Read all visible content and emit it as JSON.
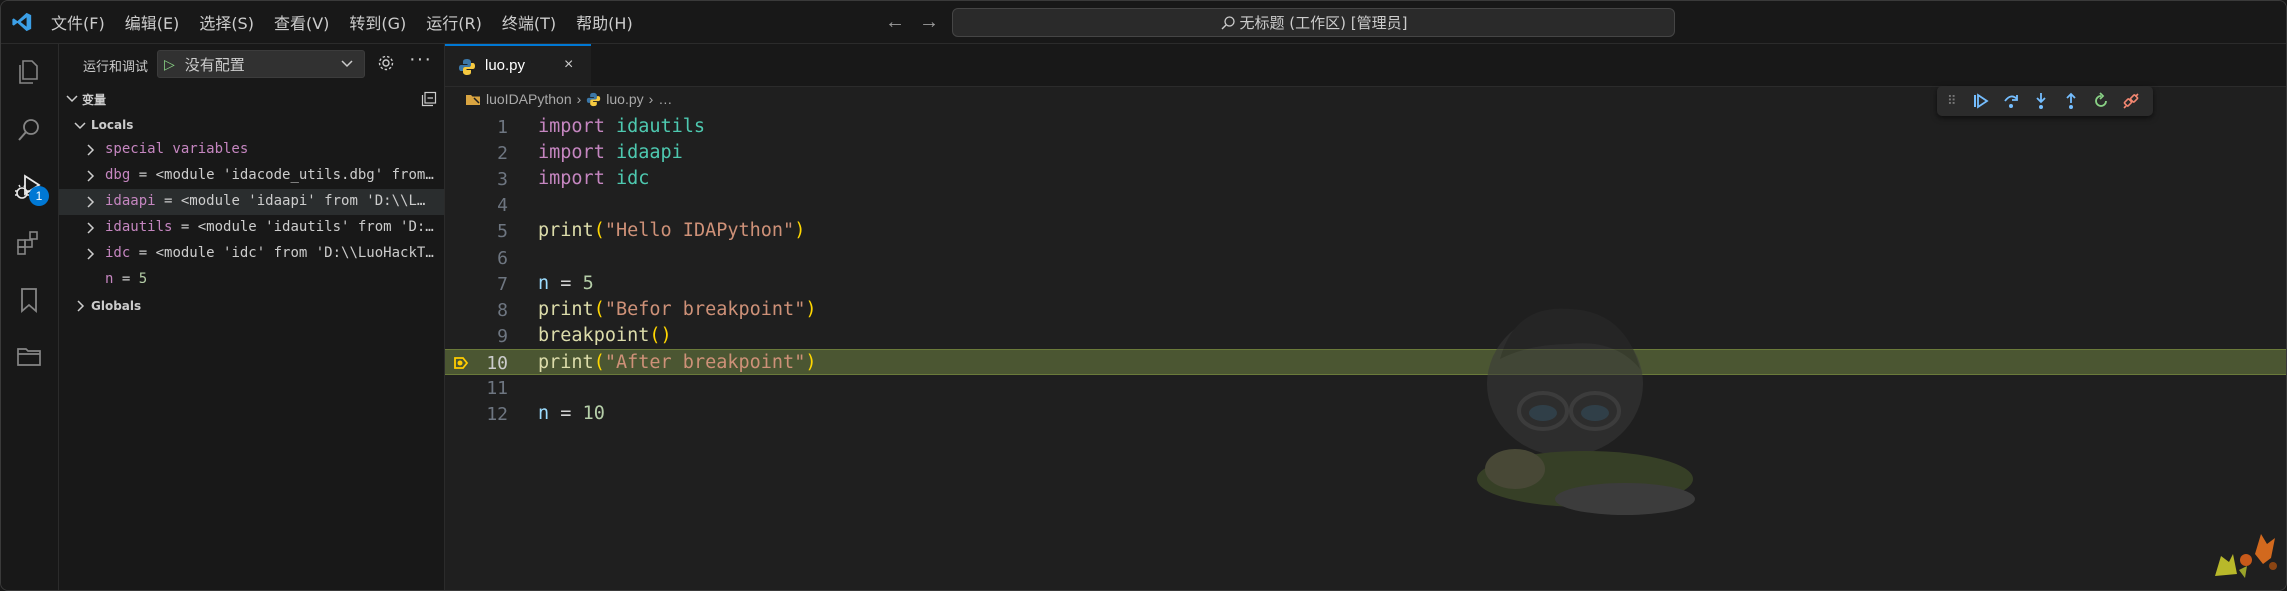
{
  "colors": {
    "accent": "#0078d4",
    "current_line": "#4b5632",
    "keyword": "#c586c0",
    "module": "#4ec9b0",
    "function": "#dcdcaa",
    "string": "#ce9178",
    "number": "#b5cea8",
    "variable": "#9cdcfe"
  },
  "menu": [
    "文件(F)",
    "编辑(E)",
    "选择(S)",
    "查看(V)",
    "转到(G)",
    "运行(R)",
    "终端(T)",
    "帮助(H)"
  ],
  "search": {
    "text": "无标题 (工作区) [管理员]"
  },
  "activity": {
    "items": [
      "explorer-icon",
      "search-icon",
      "run-debug-icon",
      "extensions-icon",
      "bookmark-icon",
      "folder-icon"
    ],
    "badge": "1"
  },
  "sidebar": {
    "title": "运行和调试",
    "config_label": "没有配置",
    "section": "变量",
    "locals": "Locals",
    "globals": "Globals",
    "variables": [
      {
        "name": "special variables",
        "eq": "",
        "value": ""
      },
      {
        "name": "dbg",
        "eq": " = ",
        "value": "<module 'idacode_utils.dbg' from…"
      },
      {
        "name": "idaapi",
        "eq": " = ",
        "value": "<module 'idaapi' from 'D:\\\\L…"
      },
      {
        "name": "idautils",
        "eq": " = ",
        "value": "<module 'idautils' from 'D:…"
      },
      {
        "name": "idc",
        "eq": " = ",
        "value": "<module 'idc' from 'D:\\\\LuoHackT…"
      },
      {
        "name": "n",
        "eq": " = ",
        "value": "5"
      }
    ]
  },
  "tab": {
    "name": "luo.py",
    "close": "×"
  },
  "breadcrumb": {
    "folder": "luoIDAPython",
    "file": "luo.py",
    "more": "…"
  },
  "editor": {
    "lines": [
      {
        "n": "1",
        "tokens": [
          [
            "kw",
            "import"
          ],
          [
            "op",
            " "
          ],
          [
            "mod",
            "idautils"
          ]
        ]
      },
      {
        "n": "2",
        "tokens": [
          [
            "kw",
            "import"
          ],
          [
            "op",
            " "
          ],
          [
            "mod",
            "idaapi"
          ]
        ]
      },
      {
        "n": "3",
        "tokens": [
          [
            "kw",
            "import"
          ],
          [
            "op",
            " "
          ],
          [
            "mod",
            "idc"
          ]
        ]
      },
      {
        "n": "4",
        "tokens": []
      },
      {
        "n": "5",
        "tokens": [
          [
            "fn",
            "print"
          ],
          [
            "par",
            "("
          ],
          [
            "str",
            "\"Hello IDAPython\""
          ],
          [
            "par",
            ")"
          ]
        ]
      },
      {
        "n": "6",
        "tokens": []
      },
      {
        "n": "7",
        "tokens": [
          [
            "var",
            "n"
          ],
          [
            "op",
            " = "
          ],
          [
            "num",
            "5"
          ]
        ]
      },
      {
        "n": "8",
        "tokens": [
          [
            "fn",
            "print"
          ],
          [
            "par",
            "("
          ],
          [
            "str",
            "\"Befor breakpoint\""
          ],
          [
            "par",
            ")"
          ]
        ]
      },
      {
        "n": "9",
        "tokens": [
          [
            "fn",
            "breakpoint"
          ],
          [
            "par",
            "()"
          ]
        ]
      },
      {
        "n": "10",
        "tokens": [
          [
            "fn",
            "print"
          ],
          [
            "par",
            "("
          ],
          [
            "str",
            "\"After breakpoint\""
          ],
          [
            "par",
            ")"
          ]
        ],
        "current": true
      },
      {
        "n": "11",
        "tokens": []
      },
      {
        "n": "12",
        "tokens": [
          [
            "var",
            "n"
          ],
          [
            "op",
            " = "
          ],
          [
            "num",
            "10"
          ]
        ]
      }
    ]
  },
  "debug_toolbar": [
    "continue-icon",
    "step-over-icon",
    "step-into-icon",
    "step-out-icon",
    "restart-icon",
    "disconnect-icon"
  ]
}
